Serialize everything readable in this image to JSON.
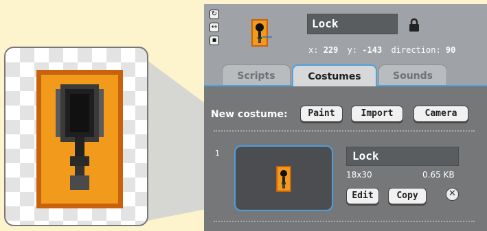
{
  "sprite": {
    "name": "Lock",
    "x_label": "x:",
    "x_value": "229",
    "y_label": "y:",
    "y_value": "-143",
    "direction_label": "direction:",
    "direction_value": "90"
  },
  "tabs": [
    {
      "label": "Scripts",
      "active": false
    },
    {
      "label": "Costumes",
      "active": true
    },
    {
      "label": "Sounds",
      "active": false
    }
  ],
  "new_costume": {
    "label": "New costume:",
    "paint": "Paint",
    "import": "Import",
    "camera": "Camera"
  },
  "costume": {
    "number": "1",
    "name": "Lock",
    "size": "18x30",
    "filesize": "0.65 KB",
    "edit": "Edit",
    "copy": "Copy",
    "delete_symbol": "✕"
  },
  "icons": [
    "rotate-icon",
    "flip-icon",
    "no-rotate-icon",
    "lock-icon",
    "delete-icon"
  ],
  "colors": {
    "background": "#fdf3cd",
    "panel": "#9fa2a6",
    "content": "#757779",
    "accent": "#4da3df",
    "sprite_orange": "#f19a1b",
    "sprite_border": "#c9620d"
  }
}
